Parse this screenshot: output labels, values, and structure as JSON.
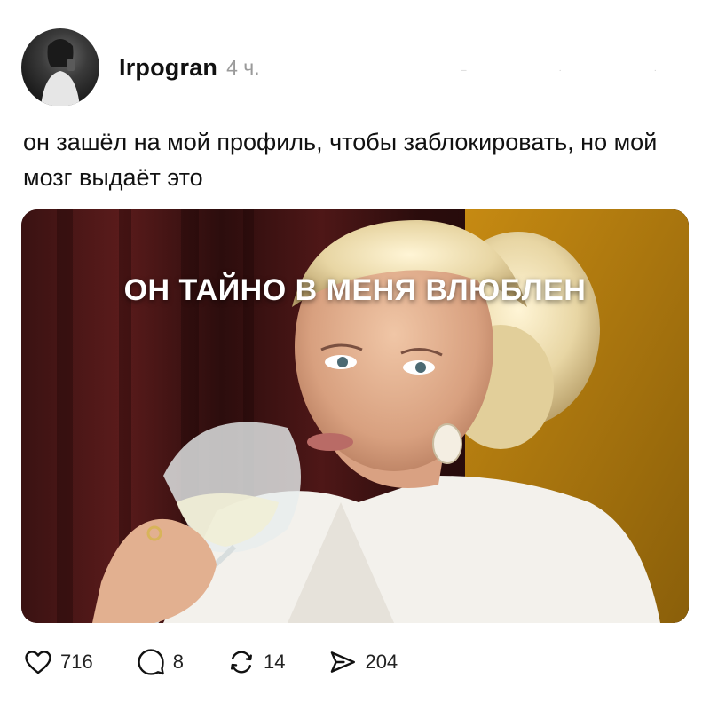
{
  "post": {
    "author": "Irpogran",
    "time": "4 ч.",
    "text": "он зашёл на мой профиль, чтобы заблокировать, но мой мозг выдаёт это",
    "image": {
      "caption": "ОН ТАЙНО В МЕНЯ ВЛЮБЛЕН",
      "description": "meme photo: blonde woman in white jacket sipping white wine"
    }
  },
  "actions": {
    "likes": {
      "icon": "heart-icon",
      "count": "716"
    },
    "comments": {
      "icon": "comment-icon",
      "count": "8"
    },
    "reposts": {
      "icon": "repost-icon",
      "count": "14"
    },
    "shares": {
      "icon": "send-icon",
      "count": "204"
    }
  },
  "colors": {
    "text": "#111111",
    "muted": "#9a9a9a",
    "background": "#ffffff"
  }
}
